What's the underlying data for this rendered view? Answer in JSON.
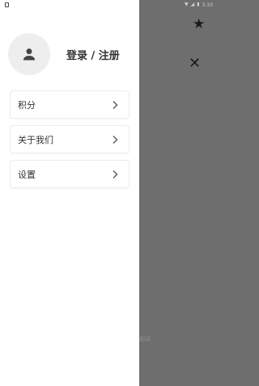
{
  "status_bar": {
    "time": "3:33",
    "icons": [
      "wifi-icon",
      "signal-icon",
      "battery-icon"
    ]
  },
  "background": {
    "star_icon": "star-icon",
    "close_icon": "close-icon",
    "faint_text": "翻译"
  },
  "drawer": {
    "login_label": "登录 / 注册",
    "menu": [
      {
        "label": "积分",
        "icon": "chevron-right-icon"
      },
      {
        "label": "关于我们",
        "icon": "chevron-right-icon"
      },
      {
        "label": "设置",
        "icon": "chevron-right-icon"
      }
    ]
  },
  "colors": {
    "drawer_bg": "#ffffff",
    "scrim": "#6e6e6e",
    "text": "#333333",
    "avatar_bg": "#eeeeee"
  }
}
